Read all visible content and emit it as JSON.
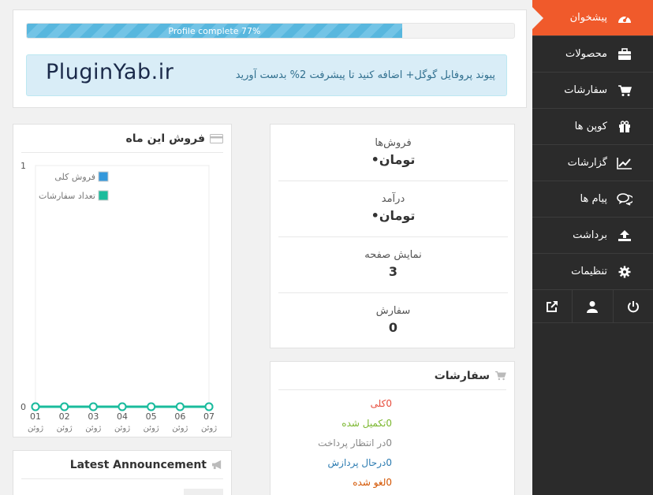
{
  "sidebar": {
    "items": [
      {
        "label": "پیشخوان",
        "icon": "dashboard-icon",
        "active": true
      },
      {
        "label": "محصولات",
        "icon": "briefcase-icon"
      },
      {
        "label": "سفارشات",
        "icon": "cart-icon"
      },
      {
        "label": "کوپن ها",
        "icon": "gift-icon"
      },
      {
        "label": "گزارشات",
        "icon": "line-chart-icon"
      },
      {
        "label": "پیام ها",
        "icon": "comments-icon"
      },
      {
        "label": "برداشت",
        "icon": "upload-icon"
      },
      {
        "label": "تنظیمات",
        "icon": "gear-icon"
      }
    ],
    "bottom_icons": [
      "external-link-icon",
      "user-icon",
      "power-icon"
    ]
  },
  "profile": {
    "progress_text": "Profile complete 77%",
    "progress_percent": 77,
    "watermark": "PluginYab.ir",
    "message": "پیوند پروفایل گوگل+ اضافه کنید تا پیشرفت 2% بدست آورید"
  },
  "stats": [
    {
      "title": "فروش‌ها",
      "value": "•تومان"
    },
    {
      "title": "درآمد",
      "value": "•تومان"
    },
    {
      "title": "نمایش صفحه",
      "value": "3"
    },
    {
      "title": "سفارش",
      "value": "0"
    }
  ],
  "orders": {
    "title": "سفارشات",
    "rows": [
      {
        "text": "0کلی",
        "color": "#e74c3c"
      },
      {
        "text": "0تکمیل شده",
        "color": "#7bb72f"
      },
      {
        "text": "0در انتظار پرداخت",
        "color": "#888888"
      },
      {
        "text": "0درحال پردازش",
        "color": "#2a7ab0"
      },
      {
        "text": "0لغو شده",
        "color": "#d35400"
      }
    ]
  },
  "sales": {
    "title": "فروش این ماه"
  },
  "announcement": {
    "title": "Latest Announcement"
  },
  "chart_data": {
    "type": "line",
    "x": [
      "01",
      "02",
      "03",
      "04",
      "05",
      "06",
      "07"
    ],
    "x_sublabel": "ژوئن",
    "ylim": [
      0,
      1
    ],
    "y_ticks": [
      "1",
      "0"
    ],
    "grid": false,
    "legend_position": "top-right",
    "series": [
      {
        "name": "فروش کلی",
        "color": "#3498db",
        "values": [
          0,
          0,
          0,
          0,
          0,
          0,
          0
        ]
      },
      {
        "name": "تعداد سفارشات",
        "color": "#1abc9c",
        "values": [
          0,
          0,
          0,
          0,
          0,
          0,
          0
        ]
      }
    ]
  }
}
